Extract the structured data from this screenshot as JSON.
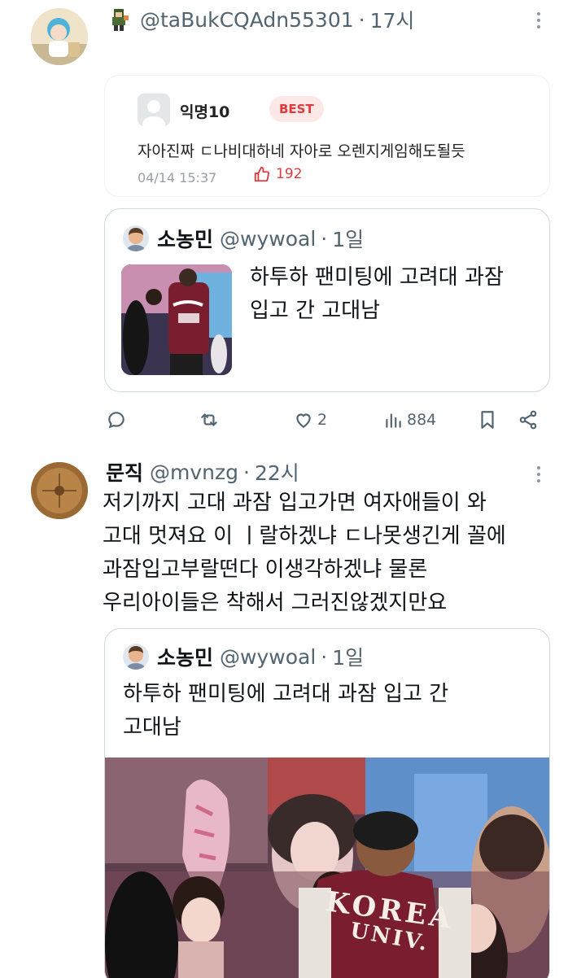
{
  "post1": {
    "handle": "@taBukCQAdn55301",
    "time": "17시",
    "embedded_comment": {
      "author": "익명10",
      "badge": "BEST",
      "text": "자아진짜 ㄷ나비대하네 자아로 오렌지게임해도될듯",
      "date": "04/14 15:37",
      "likes": "192"
    },
    "quote": {
      "name": "소농민",
      "handle": "@wywoal",
      "time": "1일",
      "text_line1": "하투하 팬미팅에 고려대 과잠",
      "text_line2": "입고 간 고대남"
    },
    "actions": {
      "replies": "",
      "retweets": "",
      "likes": "2",
      "views": "884"
    }
  },
  "post2": {
    "name": "문직",
    "handle": "@mvnzg",
    "time": "22시",
    "text_lines": [
      "저기까지 고대 과잠 입고가면 여자애들이 와",
      "고대 멋져요 이 ㅣ랄하겠냐 ㄷ나못생긴게 꼴에",
      "과잠입고부랄떤다 이생각하겠냐 물론",
      "우리아이들은 착해서 그러진않겠지만요"
    ],
    "quote": {
      "name": "소농민",
      "handle": "@wywoal",
      "time": "1일",
      "text_line1": "하투하 팬미팅에 고려대 과잠 입고 간",
      "text_line2": "고대남"
    },
    "jacket_text_line1": "KOREA",
    "jacket_text_line2": "UNIV."
  },
  "separator": "·",
  "colors": {
    "text": "#0f1419",
    "secondary": "#536471",
    "best_red": "#e0393e",
    "border": "#cfd9de",
    "jacket": "#7a1d2e"
  },
  "icons": [
    "more-icon",
    "reply-icon",
    "retweet-icon",
    "heart-icon",
    "views-icon",
    "bookmark-icon",
    "share-icon",
    "thumbs-up-icon",
    "pixel-avatar-icon"
  ]
}
